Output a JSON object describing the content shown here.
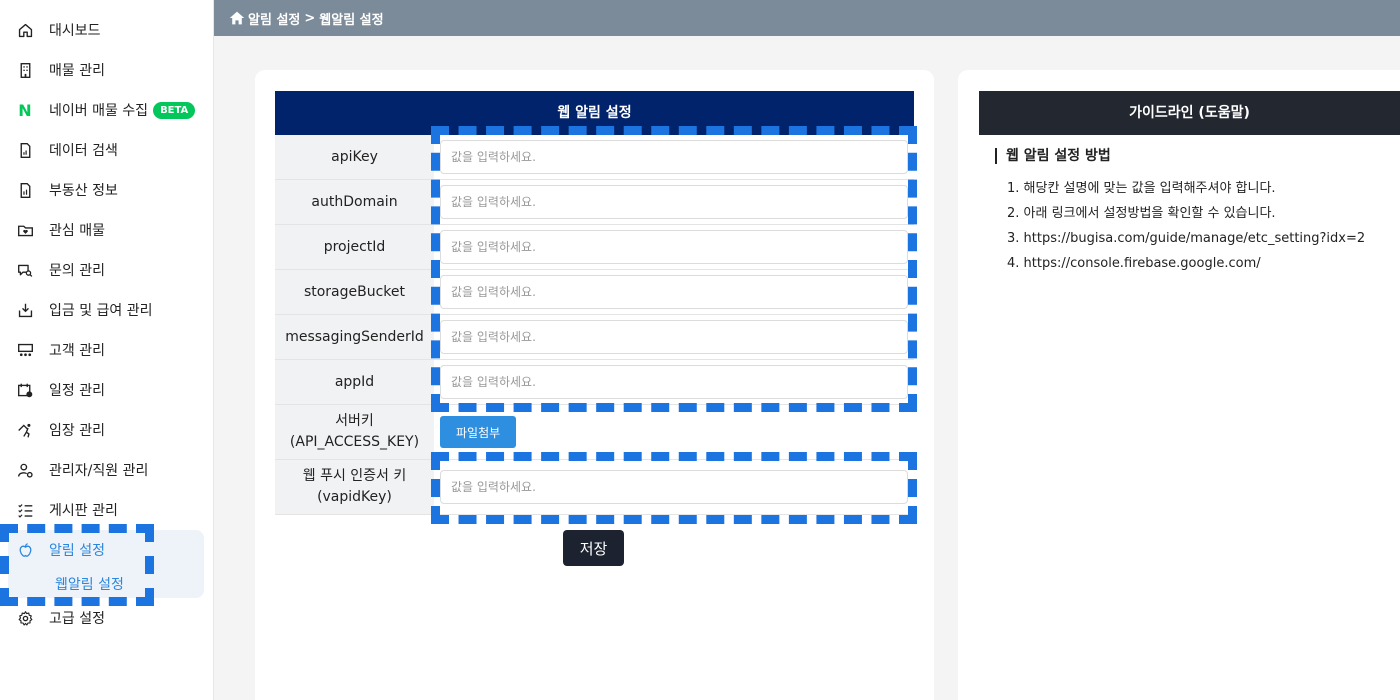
{
  "sidebar": {
    "items": [
      {
        "label": "대시보드",
        "icon": "home-icon"
      },
      {
        "label": "매물 관리",
        "icon": "building-icon"
      },
      {
        "label": "네이버 매물 수집",
        "icon": "naver-n-icon",
        "badge": "BETA",
        "logo": "N"
      },
      {
        "label": "데이터 검색",
        "icon": "document-chart-icon"
      },
      {
        "label": "부동산 정보",
        "icon": "document-info-icon"
      },
      {
        "label": "관심 매물",
        "icon": "heart-folder-icon"
      },
      {
        "label": "문의 관리",
        "icon": "chat-search-icon"
      },
      {
        "label": "입금 및 급여 관리",
        "icon": "deposit-icon"
      },
      {
        "label": "고객 관리",
        "icon": "customers-icon"
      },
      {
        "label": "일정 관리",
        "icon": "calendar-clock-icon"
      },
      {
        "label": "임장 관리",
        "icon": "field-visit-icon"
      },
      {
        "label": "관리자/직원 관리",
        "icon": "user-gear-icon"
      },
      {
        "label": "게시판 관리",
        "icon": "checklist-icon"
      },
      {
        "label": "알림 설정",
        "icon": "apple-icon",
        "active": true
      },
      {
        "label": "고급 설정",
        "icon": "gear-icon"
      }
    ],
    "subitem": "웹알림 설정"
  },
  "breadcrumb": {
    "root": "알림 설정",
    "separator": ">",
    "current": "웹알림 설정"
  },
  "form": {
    "title": "웹 알림 설정",
    "placeholder": "값을 입력하세요.",
    "rows": [
      {
        "label": "apiKey"
      },
      {
        "label": "authDomain"
      },
      {
        "label": "projectId"
      },
      {
        "label": "storageBucket"
      },
      {
        "label": "messagingSenderId"
      },
      {
        "label": "appId"
      }
    ],
    "server_key_label_1": "서버키",
    "server_key_label_2": "(API_ACCESS_KEY)",
    "file_button": "파일첨부",
    "vapid_label_1": "웹 푸시 인증서 키",
    "vapid_label_2": "(vapidKey)",
    "save_button": "저장"
  },
  "guide": {
    "header": "가이드라인 (도움말)",
    "title": "웹 알림 설정 방법",
    "lines": [
      "1. 해당칸 설명에 맞는 값을 입력해주셔야 합니다.",
      "2. 아래 링크에서 설정방법을 확인할 수 있습니다.",
      "3. https://bugisa.com/guide/manage/etc_setting?idx=2",
      "4. https://console.firebase.google.com/"
    ]
  },
  "colors": {
    "accent": "#2b86dd",
    "header_navy": "#00236b",
    "highlight": "#1c74e0",
    "naver_green": "#03c75a"
  }
}
